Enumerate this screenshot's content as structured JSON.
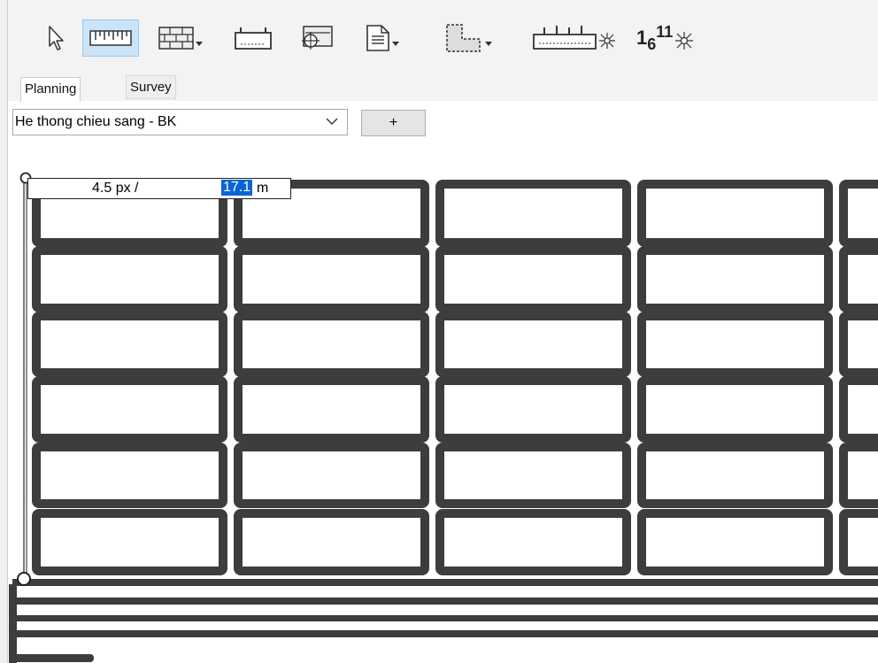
{
  "toolbar": {
    "tools": [
      {
        "id": "select",
        "icon": "arrow-cursor-icon"
      },
      {
        "id": "measure",
        "icon": "ruler-icon",
        "active": true
      },
      {
        "id": "wall",
        "icon": "brick-wall-icon",
        "dropdown": true
      },
      {
        "id": "cabinet",
        "icon": "panel-box-icon"
      },
      {
        "id": "pole",
        "icon": "pole-target-icon"
      },
      {
        "id": "document",
        "icon": "document-icon",
        "dropdown": true
      },
      {
        "id": "area",
        "icon": "l-shape-area-icon",
        "dropdown": true
      },
      {
        "id": "lighting-off",
        "icon": "panel-lights-off-icon"
      },
      {
        "id": "numbering",
        "icon": "numbering-icon",
        "label_base": "1",
        "label_sub": "6",
        "label_sup": "11"
      }
    ]
  },
  "tabs": {
    "planning": "Planning",
    "survey": "Survey"
  },
  "layer_select": {
    "value": "He thong chieu sang - BK"
  },
  "add_button": {
    "label": "+"
  },
  "scale": {
    "px_label": "4.5  px /",
    "meters": "17.1",
    "unit": "m"
  },
  "colors": {
    "road": "#3d3d3d",
    "active_tool_bg": "#cce4f7",
    "selection": "#0a64d6"
  }
}
